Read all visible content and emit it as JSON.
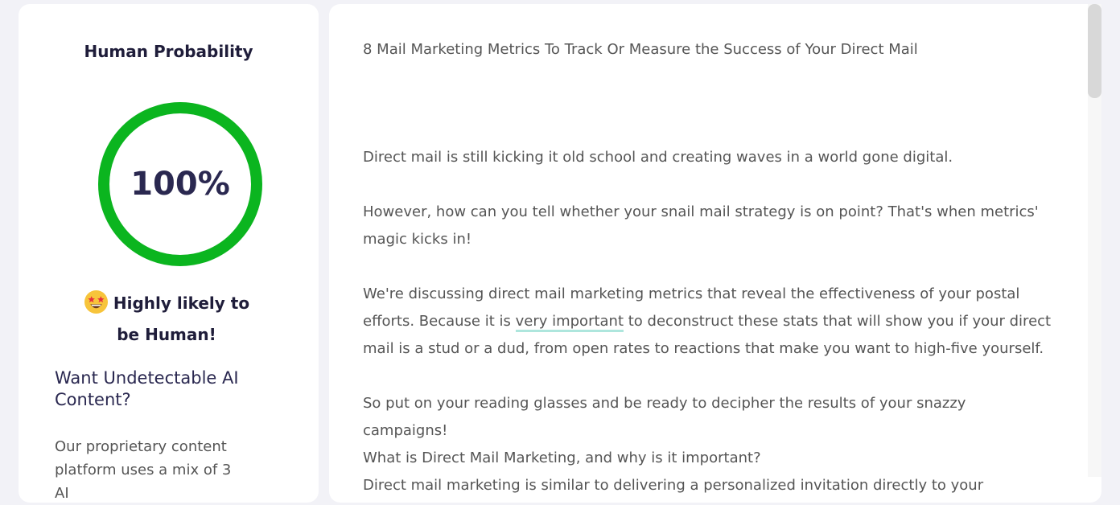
{
  "left_panel": {
    "title": "Human Probability",
    "score": "100%",
    "score_fraction": 1.0,
    "gauge_color": "#0bb51f",
    "verdict_icon": "star-struck-emoji-icon",
    "verdict": "Highly likely to be Human!",
    "promo_title": "Want Undetectable AI Content?",
    "promo_text": "Our proprietary content platform uses a mix of 3 AI"
  },
  "document": {
    "title": "8 Mail Marketing Metrics To Track Or Measure the Success of Your Direct Mail",
    "p1": "Direct mail is still kicking it old school and creating waves in a world gone digital.",
    "p2": "However, how can you tell whether your snail mail strategy is on point? That's when metrics' magic kicks in!",
    "p3_before": "We're discussing direct mail marketing metrics that reveal the effectiveness of your postal efforts. Because it is ",
    "p3_highlight": "very important",
    "p3_after": " to deconstruct these stats that will show you if your direct mail is a stud or a dud, from open rates to reactions that make you want to high-five yourself.",
    "p4": "So put on your reading glasses and be ready to decipher the results of your snazzy campaigns!",
    "p5": "What is Direct Mail Marketing, and why is it important?",
    "p6": "Direct mail marketing is similar to delivering a personalized invitation directly to your customer's mailbox."
  },
  "colors": {
    "accent_green": "#0bb51f",
    "highlight_teal": "#aee6dd"
  }
}
